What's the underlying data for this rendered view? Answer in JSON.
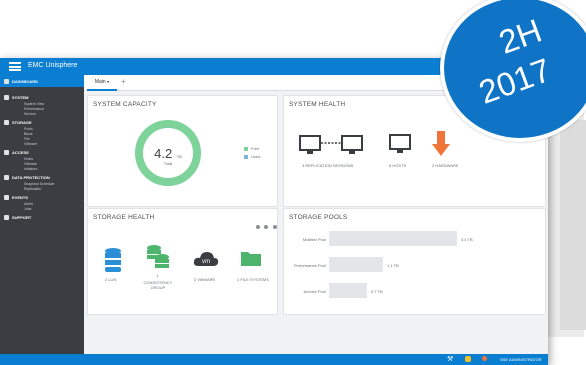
{
  "app": {
    "title": "EMC Unisphere"
  },
  "badge": {
    "line1": "2H",
    "line2": "2017"
  },
  "sidebar": {
    "dashboard": "DASHBOARD",
    "sections": [
      {
        "title": "SYSTEM",
        "items": [
          "System View",
          "Performance",
          "Service"
        ]
      },
      {
        "title": "STORAGE",
        "items": [
          "Pools",
          "Block",
          "File",
          "VMware"
        ]
      },
      {
        "title": "ACCESS",
        "items": [
          "Hosts",
          "VMware",
          "Initiators"
        ]
      },
      {
        "title": "DATA PROTECTION",
        "items": [
          "Snapshot Schedule",
          "Replication"
        ]
      },
      {
        "title": "EVENTS",
        "items": [
          "Alerts",
          "Jobs"
        ]
      },
      {
        "title": "SUPPORT",
        "items": []
      }
    ]
  },
  "tabs": {
    "main": "Main",
    "add": "+"
  },
  "capacity": {
    "title": "SYSTEM CAPACITY",
    "value": "4.2",
    "unit": "TB",
    "total_label": "Total",
    "legend_free": "Free",
    "legend_used": "Used",
    "free_color": "#7dd39a",
    "used_color": "#7ab6d8",
    "used_fraction": 0
  },
  "health": {
    "title": "SYSTEM HEALTH",
    "items": [
      {
        "label": "3  REPLICATION SESSIONS",
        "icon": "replication-icon"
      },
      {
        "label": "6  HOSTS",
        "icon": "monitor-icon"
      },
      {
        "label": "2  HARDWARE",
        "icon": "arrow-down-icon"
      }
    ]
  },
  "storage_health": {
    "title": "STORAGE HEALTH",
    "items": [
      {
        "label": "2  LUN",
        "icon": "database-icon"
      },
      {
        "count": "1",
        "label": "CONSISTENCY GROUP",
        "icon": "database-group-icon"
      },
      {
        "label": "2  VMWARE",
        "icon": "cloud-vm-icon"
      },
      {
        "label": "1  FILE SYSTEMS",
        "icon": "folder-icon"
      }
    ]
  },
  "pools": {
    "title": "STORAGE POOLS",
    "items": [
      {
        "name": "Multitier Pool",
        "value": "3.4 TB",
        "fraction": 1.0
      },
      {
        "name": "Performance Pool",
        "value": "1.1 TB",
        "fraction": 0.42
      },
      {
        "name": "Archive Pool",
        "value": "0.7 TB",
        "fraction": 0.3
      }
    ]
  },
  "status": {
    "right_text": "SSE ADMINISTRATOR"
  }
}
